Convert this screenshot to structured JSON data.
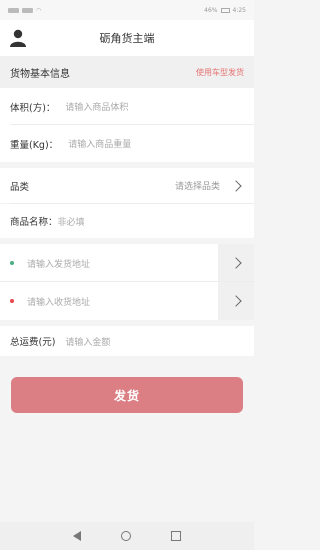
{
  "status_bar": {
    "battery": "46%",
    "time": "4:25"
  },
  "header": {
    "title": "砺角货主端"
  },
  "section": {
    "title": "货物基本信息",
    "link": "使用车型发货"
  },
  "volume": {
    "label": "体积(方)：",
    "placeholder": "请输入商品体积"
  },
  "weight": {
    "label": "重量(Kg)：",
    "placeholder": "请输入商品重量"
  },
  "category": {
    "label": "品类",
    "placeholder": "请选择品类"
  },
  "product_name": {
    "label": "商品名称：",
    "placeholder": "非必填"
  },
  "ship_address": {
    "placeholder": "请输入发货地址"
  },
  "receive_address": {
    "placeholder": "请输入收货地址"
  },
  "freight": {
    "label": "总运费(元)",
    "placeholder": "请输入金额"
  },
  "submit": {
    "label": "发货"
  },
  "colors": {
    "accent": "#db7f84",
    "ship_dot": "#4caf81",
    "receive_dot": "#e5484d"
  }
}
